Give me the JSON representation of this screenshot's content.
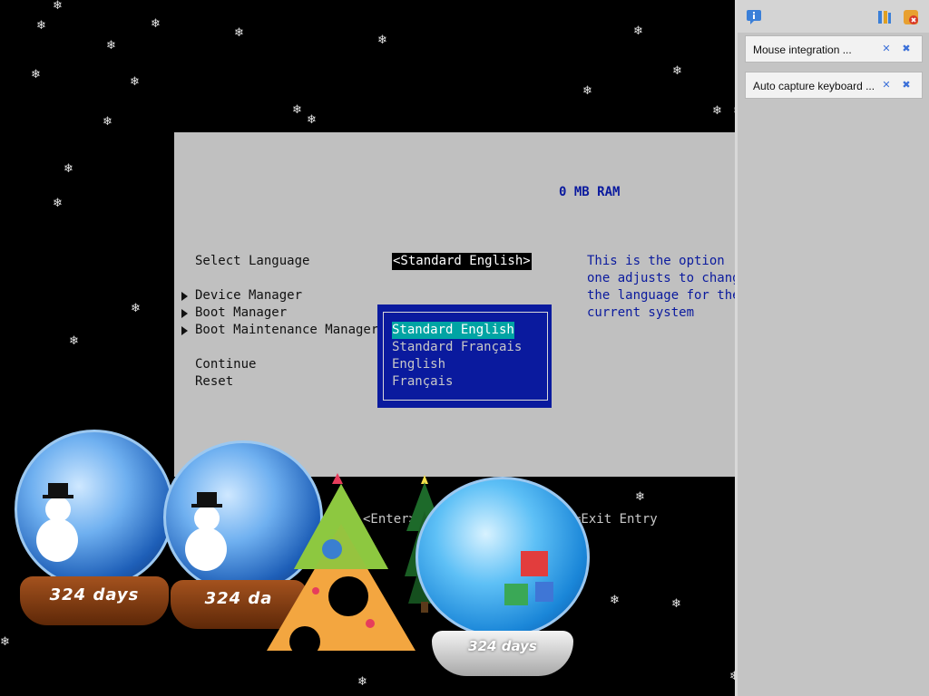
{
  "bios": {
    "ram": "0 MB RAM",
    "select_language_label": "Select Language",
    "select_language_value": "<Standard English>",
    "menu": {
      "device_manager": "Device Manager",
      "boot_manager": "Boot Manager",
      "boot_maintenance_manager": "Boot Maintenance Manager",
      "continue": "Continue",
      "reset": "Reset"
    },
    "help_lines": [
      "This is the option",
      "one adjusts to change",
      "the language for the",
      "current system"
    ],
    "language_options": [
      "Standard English",
      "Standard Français",
      "English",
      "Français"
    ],
    "selected_option_index": 0,
    "footer_enter": "<Enter>",
    "footer_exit": "=Exit Entry"
  },
  "side_panel": {
    "notifications": [
      {
        "text": "Mouse integration ..."
      },
      {
        "text": "Auto capture keyboard ..."
      }
    ]
  },
  "widgets": {
    "globe_days": [
      "324 days",
      "324 da",
      "324 days"
    ]
  },
  "icons": [
    "vbox-info-icon",
    "vbox-settings-icon",
    "vbox-close-icon",
    "dismiss-icon",
    "pin-icon"
  ],
  "colors": {
    "bios_bg": "#c0c0c0",
    "bios_blue": "#0a1a9e",
    "popup_bg": "#0a1a9e",
    "selected_bg": "#00a4a4",
    "side_panel_bg": "#c4c4c4"
  }
}
